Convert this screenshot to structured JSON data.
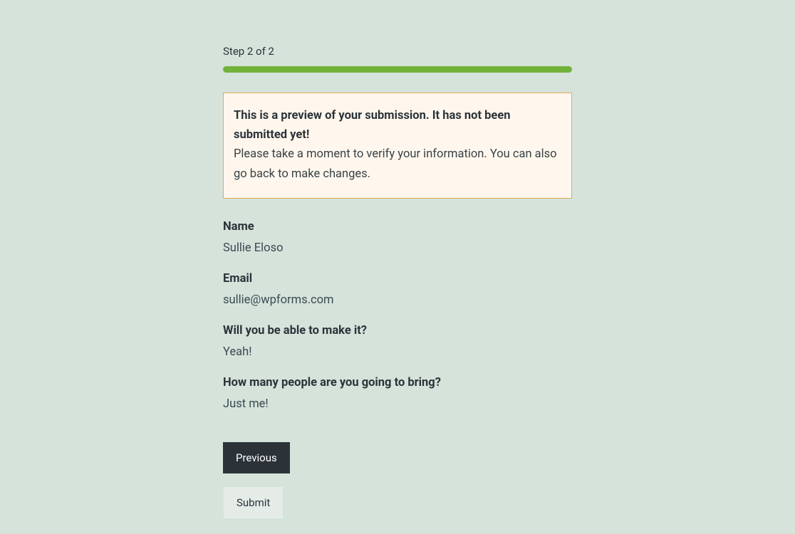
{
  "progress": {
    "label": "Step 2 of 2"
  },
  "notice": {
    "title": "This is a preview of your submission. It has not been submitted yet!",
    "description": "Please take a moment to verify your information. You can also go back to make changes."
  },
  "fields": {
    "name": {
      "label": "Name",
      "value": "Sullie Eloso"
    },
    "email": {
      "label": "Email",
      "value": "sullie@wpforms.com"
    },
    "attendance": {
      "label": "Will you be able to make it?",
      "value": "Yeah!"
    },
    "guests": {
      "label": "How many people are you going to bring?",
      "value": "Just me!"
    }
  },
  "buttons": {
    "previous": "Previous",
    "submit": "Submit"
  }
}
